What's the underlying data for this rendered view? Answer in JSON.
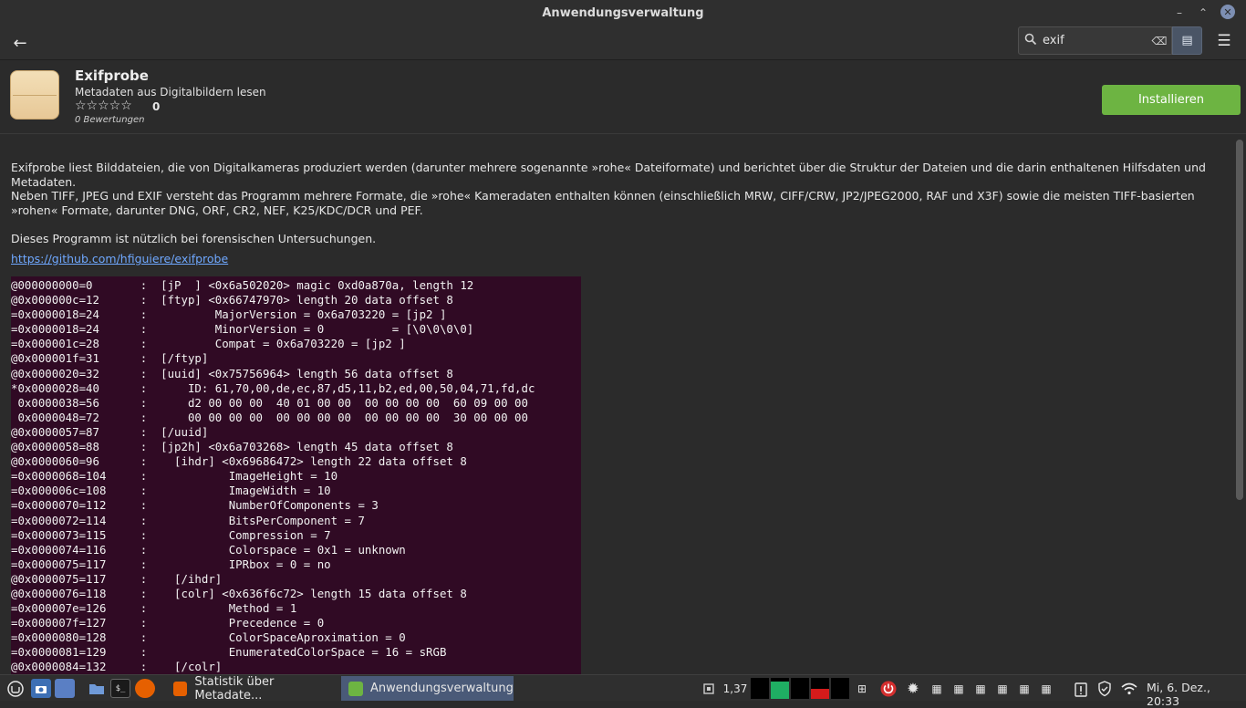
{
  "window": {
    "title": "Anwendungsverwaltung",
    "min_glyph": "–",
    "max_glyph": "⌃",
    "close_glyph": "✕"
  },
  "toolbar": {
    "back_glyph": "←",
    "search_value": "exif",
    "search_icon": "search-icon",
    "clear_glyph": "⌫",
    "search_mode_glyph": "▤",
    "menu_glyph": "☰"
  },
  "app": {
    "name": "Exifprobe",
    "summary": "Metadaten aus Digitalbildern lesen",
    "stars": "☆☆☆☆☆",
    "rating": "0",
    "reviews": "0 Bewertungen",
    "install_label": "Installieren"
  },
  "description": {
    "p1": "Exifprobe liest Bilddateien, die von Digitalkameras produziert werden (darunter mehrere sogenannte »rohe« Dateiformate) und berichtet über die Struktur der Dateien und die darin enthaltenen Hilfsdaten und Metadaten.",
    "p2": "Neben TIFF, JPEG und EXIF versteht das Programm mehrere Formate, die »rohe« Kameradaten enthalten können (einschließlich MRW, CIFF/CRW, JP2/JPEG2000, RAF und X3F) sowie die meisten TIFF-basierten »rohen« Formate, darunter DNG, ORF, CR2, NEF, K25/KDC/DCR und PEF.",
    "p3": "Dieses Programm ist nützlich bei forensischen Untersuchungen.",
    "link": "https://github.com/hfiguiere/exifprobe"
  },
  "screenshot_lines": [
    "@000000000=0       :  [jP  ] <0x6a502020> magic 0xd0a870a, length 12",
    "@0x000000c=12      :  [ftyp] <0x66747970> length 20 data offset 8",
    "=0x0000018=24      :          MajorVersion = 0x6a703220 = [jp2 ]",
    "=0x0000018=24      :          MinorVersion = 0          = [\\0\\0\\0\\0]",
    "=0x000001c=28      :          Compat = 0x6a703220 = [jp2 ]",
    "@0x000001f=31      :  [/ftyp]",
    "@0x0000020=32      :  [uuid] <0x75756964> length 56 data offset 8",
    "*0x0000028=40      :      ID: 61,70,00,de,ec,87,d5,11,b2,ed,00,50,04,71,fd,dc",
    " 0x0000038=56      :      d2 00 00 00  40 01 00 00  00 00 00 00  60 09 00 00",
    " 0x0000048=72      :      00 00 00 00  00 00 00 00  00 00 00 00  30 00 00 00",
    "@0x0000057=87      :  [/uuid]",
    "@0x0000058=88      :  [jp2h] <0x6a703268> length 45 data offset 8",
    "@0x0000060=96      :    [ihdr] <0x69686472> length 22 data offset 8",
    "=0x0000068=104     :            ImageHeight = 10",
    "=0x000006c=108     :            ImageWidth = 10",
    "=0x0000070=112     :            NumberOfComponents = 3",
    "=0x0000072=114     :            BitsPerComponent = 7",
    "=0x0000073=115     :            Compression = 7",
    "=0x0000074=116     :            Colorspace = 0x1 = unknown",
    "=0x0000075=117     :            IPRbox = 0 = no",
    "@0x0000075=117     :    [/ihdr]",
    "@0x0000076=118     :    [colr] <0x636f6c72> length 15 data offset 8",
    "=0x000007e=126     :            Method = 1",
    "=0x000007f=127     :            Precedence = 0",
    "=0x0000080=128     :            ColorSpaceAproximation = 0",
    "=0x0000081=129     :            EnumeratedColorSpace = 16 = sRGB",
    "@0x0000084=132     :    [/colr]"
  ],
  "taskbar": {
    "tasks": [
      {
        "label": "Statistik über Metadate...",
        "icon": "firefox-icon",
        "color": "#e66000"
      },
      {
        "label": "Anwendungsverwaltung",
        "icon": "software-manager-icon",
        "color": "#6db442"
      }
    ],
    "tray": {
      "cpu_value": "1,37",
      "clock": "Mi, 6. Dez., 20:33"
    },
    "colors": {
      "active_task": "#4a5a78",
      "accent_green": "#6db442",
      "power_red": "#d32f2f"
    }
  }
}
